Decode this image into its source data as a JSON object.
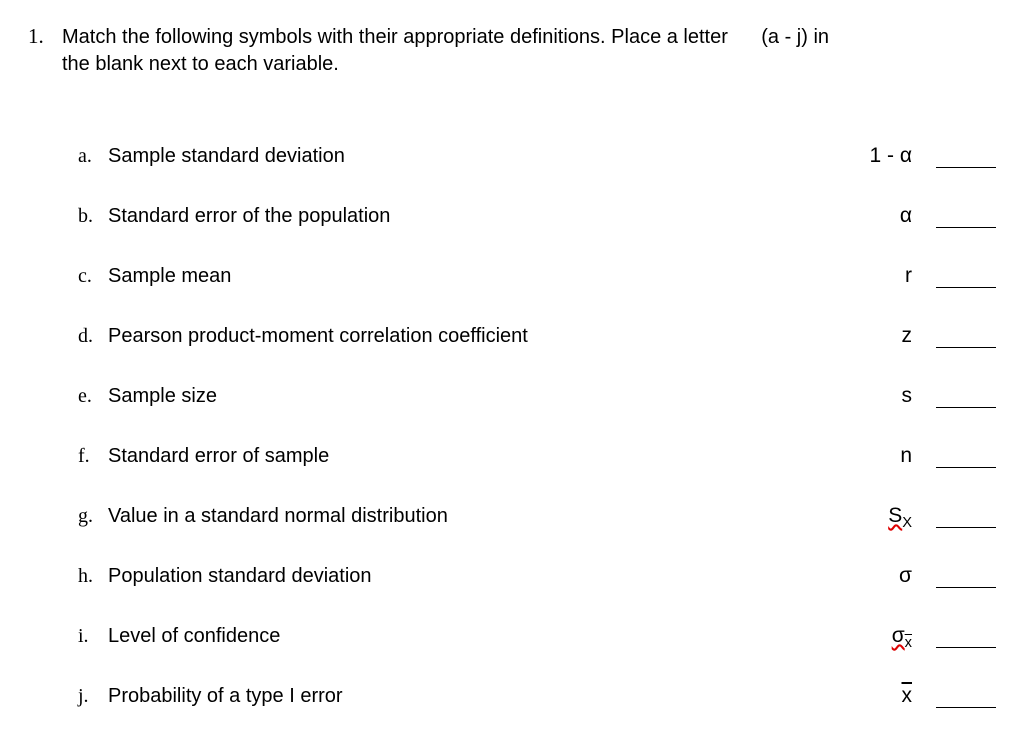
{
  "question": {
    "number": "1.",
    "text": "Match the following symbols with their appropriate definitions.  Place a letter",
    "hint": "      (a - j) in",
    "text2": "the blank next to each variable."
  },
  "rows": [
    {
      "letter": "a.",
      "definition": "Sample standard deviation",
      "symbol_html": "1 - α"
    },
    {
      "letter": "b.",
      "definition": "Standard error of the population",
      "symbol_html": "α"
    },
    {
      "letter": "c.",
      "definition": "Sample mean",
      "symbol_html": "r"
    },
    {
      "letter": "d.",
      "definition": "Pearson product-moment correlation coefficient",
      "symbol_html": "z"
    },
    {
      "letter": "e.",
      "definition": "Sample size",
      "symbol_html": "s"
    },
    {
      "letter": "f.",
      "definition": "Standard error of sample",
      "symbol_html": "n"
    },
    {
      "letter": "g.",
      "definition": "Value in a standard normal distribution",
      "symbol_html": "<span class='redwave'>S<span class='subscript'>X</span></span>"
    },
    {
      "letter": "h.",
      "definition": "Population standard deviation",
      "symbol_html": "σ"
    },
    {
      "letter": "i.",
      "definition": "Level of confidence",
      "symbol_html": "<span class='redwave'>σ<span class='subscript overline'>x</span></span>"
    },
    {
      "letter": "j.",
      "definition": "Probability of a type I error",
      "symbol_html": "<span class='overline'>x</span>"
    }
  ]
}
